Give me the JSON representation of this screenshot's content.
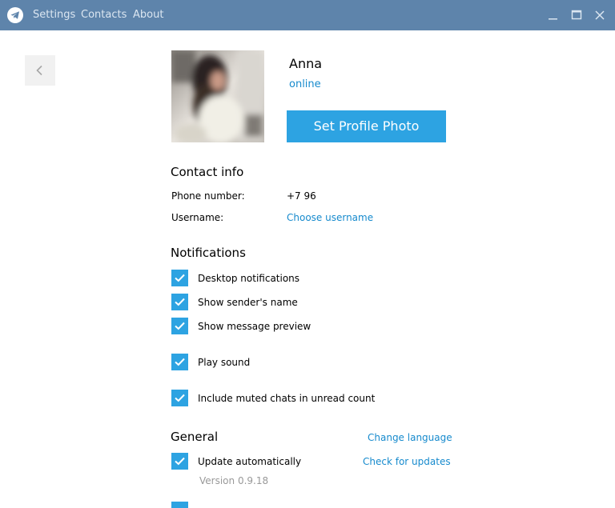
{
  "titlebar": {
    "menu": {
      "settings": "Settings",
      "contacts": "Contacts",
      "about": "About"
    },
    "icons": [
      "telegram-logo-icon",
      "minimize-icon",
      "maximize-icon",
      "close-icon"
    ],
    "background_color": "#5e84ab"
  },
  "profile": {
    "name": "Anna",
    "status": "online",
    "set_photo_button": "Set Profile Photo"
  },
  "contact_info": {
    "title": "Contact info",
    "phone_label": "Phone number:",
    "phone_value": "+7 96",
    "username_label": "Username:",
    "username_link": "Choose username"
  },
  "notifications": {
    "title": "Notifications",
    "items": [
      {
        "label": "Desktop notifications",
        "checked": true
      },
      {
        "label": "Show sender's name",
        "checked": true
      },
      {
        "label": "Show message preview",
        "checked": true
      },
      {
        "label": "Play sound",
        "checked": true
      },
      {
        "label": "Include muted chats in unread count",
        "checked": true
      }
    ]
  },
  "general": {
    "title": "General",
    "change_language": "Change language",
    "update_label": "Update automatically",
    "update_checked": true,
    "check_updates": "Check for updates",
    "version": "Version 0.9.18"
  },
  "colors": {
    "accent": "#2da3e2",
    "link": "#168acd"
  }
}
